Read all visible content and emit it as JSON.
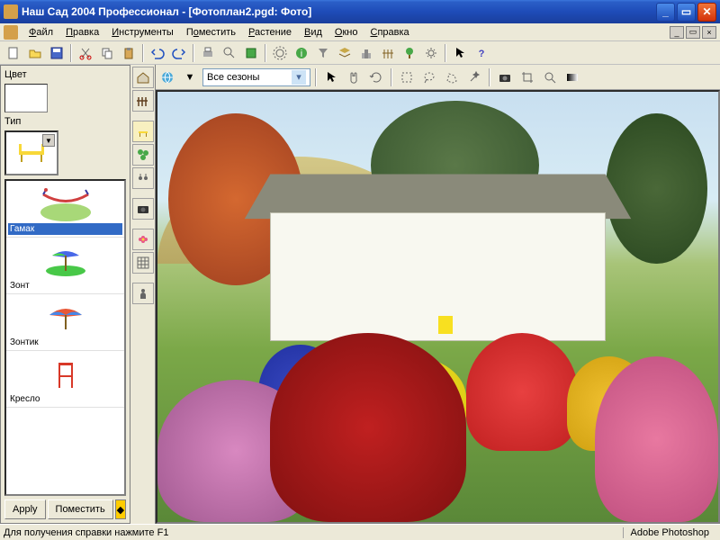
{
  "window": {
    "title": "Наш Сад 2004 Профессионал - [Фотоплан2.pgd: Фото]"
  },
  "menu": {
    "file": "Файл",
    "edit": "Правка",
    "tools": "Инструменты",
    "place": "Поместить",
    "plant": "Растение",
    "view": "Вид",
    "window": "Окно",
    "help": "Справка"
  },
  "left_panel": {
    "color_label": "Цвет",
    "type_label": "Тип",
    "items": [
      {
        "label": "Гамак",
        "color": "#a8d878",
        "selected": true
      },
      {
        "label": "Зонт",
        "color": "#48c848",
        "selected": false
      },
      {
        "label": "Зонтик",
        "color": "#e85838",
        "selected": false
      },
      {
        "label": "Кресло",
        "color": "#d83828",
        "selected": false
      }
    ],
    "apply_btn": "Apply",
    "place_btn": "Поместить"
  },
  "viewport_toolbar": {
    "season": "Все сезоны"
  },
  "statusbar": {
    "hint": "Для получения справки нажмите F1",
    "app": "Adobe Photoshop"
  },
  "colors": {
    "titlebar_start": "#3b77dd",
    "titlebar_end": "#1a3f9c",
    "bg": "#ece9d8",
    "selection": "#316ac5"
  }
}
